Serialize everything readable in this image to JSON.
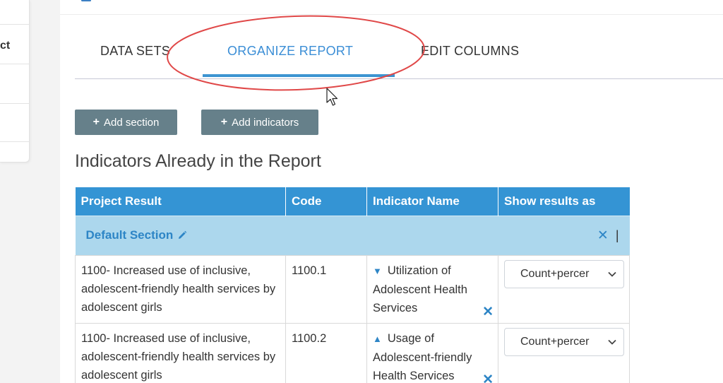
{
  "sidebar": {
    "fragment_text": "ct"
  },
  "tabs": [
    {
      "label": "DATA SETS",
      "active": false
    },
    {
      "label": "ORGANIZE REPORT",
      "active": true
    },
    {
      "label": "EDIT COLUMNS",
      "active": false
    }
  ],
  "toolbar": {
    "add_section_label": "Add section",
    "add_indicators_label": "Add indicators",
    "plus_icon": "+"
  },
  "section_heading": "Indicators Already in the Report",
  "table": {
    "headers": [
      "Project Result",
      "Code",
      "Indicator Name",
      "Show results as"
    ],
    "section": {
      "name": "Default Section",
      "remove_icon": "✕",
      "drag_icon": "|"
    },
    "rows": [
      {
        "project_result": "1100- Increased use of inclusive, adolescent-friendly health services by adolescent girls",
        "code": "1100.1",
        "indicator_name": "Utilization of Adolescent Health Services",
        "sort_icon": "▼",
        "remove_icon": "✕",
        "show_results_as": "Count+percer"
      },
      {
        "project_result": "1100- Increased use of inclusive, adolescent-friendly health services by adolescent girls",
        "code": "1100.2",
        "indicator_name": "Usage of Adolescent-friendly Health Services",
        "sort_icon": "▲",
        "remove_icon": "✕",
        "show_results_as": "Count+percer"
      }
    ]
  },
  "colors": {
    "accent": "#3b8ed6",
    "table_header": "#3494d4",
    "section_row": "#acd7ed",
    "button": "#66808a",
    "annotation": "#e04848"
  }
}
